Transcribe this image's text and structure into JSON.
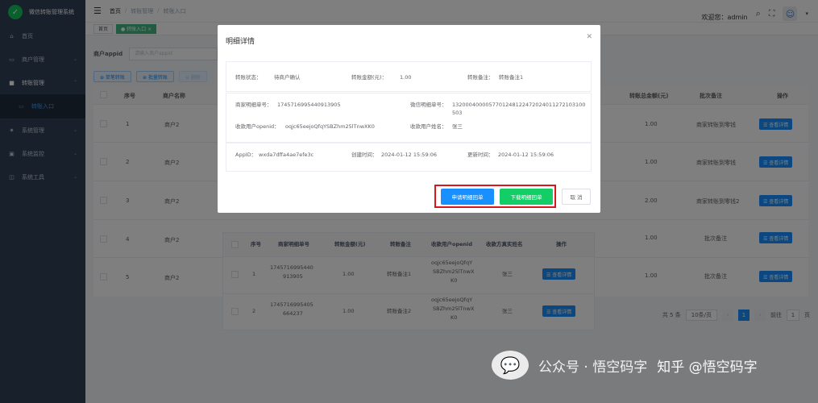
{
  "app": {
    "title": "微信转账管理系统"
  },
  "sidebar": {
    "items": [
      {
        "icon": "home-icon",
        "label": "首页"
      },
      {
        "icon": "store-icon",
        "label": "商户管理"
      },
      {
        "icon": "transfer-icon",
        "label": "转账管理"
      },
      {
        "icon": "entry-icon",
        "label": "转账入口"
      },
      {
        "icon": "gear-icon",
        "label": "系统管理"
      },
      {
        "icon": "monitor-icon",
        "label": "系统监控"
      },
      {
        "icon": "tool-icon",
        "label": "系统工具"
      }
    ]
  },
  "navbar": {
    "breadcrumb": [
      "首页",
      "转账管理",
      "转账入口"
    ],
    "welcome": "欢迎您：admin"
  },
  "tags": {
    "home": "首页",
    "active": "● 转账入口 ×"
  },
  "filter": {
    "label": "商户appid",
    "placeholder": "请输入商户appid"
  },
  "toolbar": {
    "b1": "⊕ 单笔转账",
    "b2": "⊕ 批量转账",
    "b3": "⊖ 删除"
  },
  "table": {
    "headers": {
      "index": "序号",
      "name": "商户名称",
      "amount": "转账总金额(元)",
      "remark": "批次备注",
      "op": "操作"
    },
    "rows": [
      {
        "index": "1",
        "name": "商户2",
        "amount": "1.00",
        "remark": "商家转账到零钱"
      },
      {
        "index": "2",
        "name": "商户2",
        "amount": "1.00",
        "remark": "商家转账到零钱"
      },
      {
        "index": "3",
        "name": "商户2",
        "amount": "2.00",
        "remark": "商家转账到零钱2"
      },
      {
        "index": "4",
        "name": "商户2",
        "amount": "1.00",
        "remark": "批次备注"
      },
      {
        "index": "5",
        "name": "商户2",
        "amount": "1.00",
        "remark": "批次备注"
      }
    ],
    "view_label": "☰ 查看详情"
  },
  "nested": {
    "headers": {
      "index": "序号",
      "no": "商家明细单号",
      "amount": "转账金额(元)",
      "remark": "转账备注",
      "openid": "收款用户openid",
      "name": "收款方真实姓名",
      "op": "操作"
    },
    "rows": [
      {
        "index": "1",
        "no1": "1745716995440",
        "no2": "913905",
        "amount": "1.00",
        "remark": "转账备注1",
        "o1": "oqjc65eejoQfqY",
        "o2": "SBZhm25lTnwX",
        "o3": "K0",
        "name": "张三"
      },
      {
        "index": "2",
        "no1": "1745716995405",
        "no2": "664237",
        "amount": "1.00",
        "remark": "转账备注2",
        "o1": "oqjc65eejoQfqY",
        "o2": "SBZhm25lTnwX",
        "o3": "K0",
        "name": "张三"
      }
    ],
    "view_label": "☰ 查看详情"
  },
  "pager": {
    "total": "共 5 条",
    "size": "10条/页",
    "page": "1",
    "goto": "前往",
    "goto_val": "1",
    "unit": "页"
  },
  "dialog": {
    "title": "明细详情",
    "status_label": "转账状态：",
    "status": "待商户确认",
    "amount_label": "转账金额(元)：",
    "amount": "1.00",
    "remark_label": "转账备注：",
    "remark": "转账备注1",
    "merchant_no_label": "商家明细单号：",
    "merchant_no": "1745716995440913905",
    "wx_no_label": "微信明细单号：",
    "wx_no_1": "1320004000057701248122472024011272103100",
    "wx_no_2": "503",
    "openid_label": "收款用户openid：",
    "openid": "oqjc65eejoQfqYSBZhm25lTnwXK0",
    "username_label": "收款用户姓名：",
    "username": "张三",
    "appid_label": "AppID：",
    "appid": "wxda7dffa4ae7efe3c",
    "created_label": "创建时间：",
    "created": "2024-01-12 15:59:06",
    "updated_label": "更新时间：",
    "updated": "2024-01-12 15:59:06",
    "btn_apply": "申请明细回单",
    "btn_download": "下载明细回单",
    "btn_cancel": "取 消"
  },
  "watermark": {
    "a": "公众号 · 悟空码字",
    "b": "知乎 @悟空码字"
  }
}
